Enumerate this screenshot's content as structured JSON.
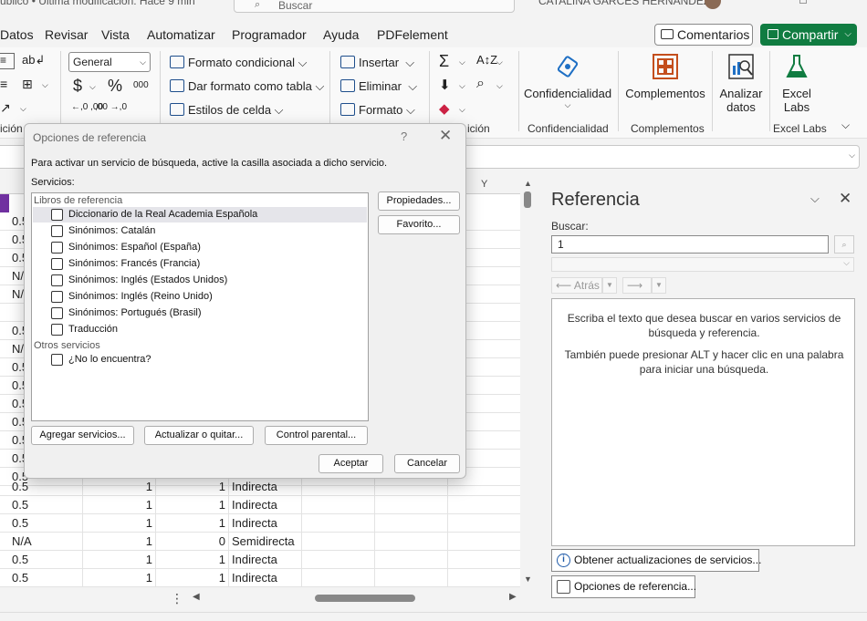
{
  "titlebar": {
    "title": "ublico • Última modificación: Hace 9 min",
    "search_placeholder": "Buscar",
    "user": "CATALINA GARCÉS HERNÁNDEZ"
  },
  "menu": {
    "items": [
      "Datos",
      "Revisar",
      "Vista",
      "Automatizar",
      "Programador",
      "Ayuda",
      "PDFelement"
    ],
    "comments": "Comentarios",
    "share": "Compartir"
  },
  "ribbon": {
    "number_format": "General",
    "currency": "$",
    "percent": "%",
    "thousands": "000",
    "dec_inc": "←,0 ,00",
    "dec_dec": ",00 →,0",
    "styles": {
      "conditional": "Formato condicional",
      "table": "Dar formato como tabla",
      "cell": "Estilos de celda"
    },
    "cells": {
      "insert": "Insertar",
      "delete": "Eliminar",
      "format": "Formato"
    },
    "editing_label": "ición",
    "alignment_label": "ición",
    "confidentiality": "Confidencialidad",
    "confidentiality_group": "Confidencialidad",
    "addins": "Complementos",
    "addins_group": "Complementos",
    "analyze_line1": "Analizar",
    "analyze_line2": "datos",
    "excellabs_line1": "Excel",
    "excellabs_line2": "Labs",
    "excellabs_group": "Excel Labs"
  },
  "grid": {
    "col_y": "Y",
    "rows_top": [
      {
        "a": "0.5"
      },
      {
        "a": "0.5"
      },
      {
        "a": "0.5"
      },
      {
        "a": "N/A"
      },
      {
        "a": "N/A"
      },
      {
        "a": ""
      },
      {
        "a": "0.5"
      },
      {
        "a": "N/A"
      },
      {
        "a": "0.5"
      },
      {
        "a": "0.5"
      },
      {
        "a": "0.5"
      },
      {
        "a": "0.5"
      },
      {
        "a": "0.5"
      },
      {
        "a": "0.5"
      },
      {
        "a": "0.5"
      }
    ],
    "rows": [
      {
        "a": "0.5",
        "b": "1",
        "c": "1",
        "d": "Indirecta"
      },
      {
        "a": "0.5",
        "b": "1",
        "c": "1",
        "d": "Indirecta"
      },
      {
        "a": "0.5",
        "b": "1",
        "c": "1",
        "d": "Indirecta"
      },
      {
        "a": "N/A",
        "b": "1",
        "c": "0",
        "d": "Semidirecta"
      },
      {
        "a": "0.5",
        "b": "1",
        "c": "1",
        "d": "Indirecta"
      },
      {
        "a": "0.5",
        "b": "1",
        "c": "1",
        "d": "Indirecta"
      }
    ]
  },
  "dialog": {
    "title": "Opciones de referencia",
    "help": "?",
    "close": "✕",
    "instruction": "Para activar un servicio de búsqueda, active la casilla asociada a dicho servicio.",
    "services_label": "Servicios:",
    "group1": "Libros de referencia",
    "items1": [
      "Diccionario de la Real Academia Española",
      "Sinónimos: Catalán",
      "Sinónimos: Español (España)",
      "Sinónimos: Francés (Francia)",
      "Sinónimos: Inglés (Estados Unidos)",
      "Sinónimos: Inglés (Reino Unido)",
      "Sinónimos: Portugués (Brasil)",
      "Traducción"
    ],
    "group2": "Otros servicios",
    "items2": [
      "¿No lo encuentra?"
    ],
    "properties": "Propiedades...",
    "favorite": "Favorito...",
    "add_services": "Agregar servicios...",
    "update_remove": "Actualizar o quitar...",
    "parental": "Control parental...",
    "ok": "Aceptar",
    "cancel": "Cancelar"
  },
  "refpane": {
    "title": "Referencia",
    "search_label": "Buscar:",
    "search_value": "1",
    "back": "Atrás",
    "hint1": "Escriba el texto que desea buscar en varios servicios de búsqueda y referencia.",
    "hint2": "También puede presionar ALT y hacer clic en una palabra para iniciar una búsqueda.",
    "update_services": "Obtener actualizaciones de servicios...",
    "options": "Opciones de referencia..."
  },
  "colors": {
    "accent_green": "#107c41",
    "purple": "#7030a0"
  }
}
